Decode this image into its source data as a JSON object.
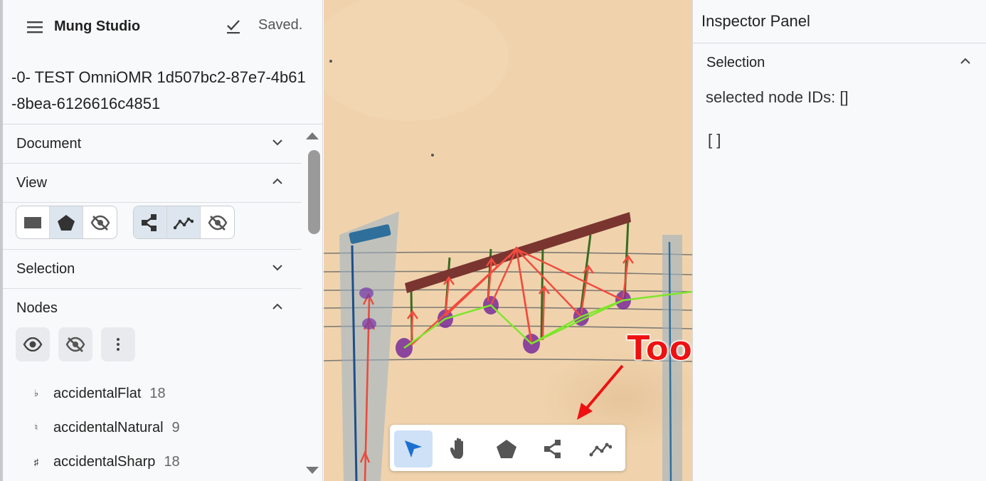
{
  "app": {
    "title": "Mung Studio",
    "save_status": "Saved."
  },
  "document": {
    "title": "-0- TEST OmniOMR 1d507bc2-87e7-4b61-8bea-6126616c4851"
  },
  "sidebar": {
    "sections": {
      "document": "Document",
      "view": "View",
      "selection": "Selection",
      "nodes": "Nodes"
    },
    "view_buttons": {
      "node_display": [
        "rectangle-icon",
        "polygon-icon",
        "eye-off-icon"
      ],
      "node_display_selected": "polygon-icon",
      "link_display": [
        "syntax-links-icon",
        "precedence-links-icon",
        "eye-off-icon"
      ],
      "link_display_selected": [
        "syntax-links-icon",
        "precedence-links-icon"
      ]
    },
    "node_actions": [
      "eye-icon",
      "eye-off-icon",
      "more-vert-icon"
    ],
    "node_classes": [
      {
        "glyph": "♭",
        "name": "accidentalFlat",
        "count": "18"
      },
      {
        "glyph": "♮",
        "name": "accidentalNatural",
        "count": "9"
      },
      {
        "glyph": "♯",
        "name": "accidentalSharp",
        "count": "18"
      }
    ]
  },
  "canvas": {
    "annotation": "Toolbelt",
    "toolbelt": {
      "tools": [
        "pointer-icon",
        "hand-icon",
        "polygon-icon",
        "syntax-link-icon",
        "precedence-link-icon"
      ],
      "active": "pointer-icon"
    }
  },
  "inspector": {
    "title": "Inspector Panel",
    "section": "Selection",
    "selected_label": "selected node IDs: []",
    "array_text": "[ ]"
  },
  "colors": {
    "paper": "#f0d3ad",
    "syntax_link": "#f24a3d",
    "precedence_link": "#7de62a",
    "annotation": "#ee1111",
    "active_tool": "#cfe1f6",
    "pointer_blue": "#1c6fd0"
  }
}
